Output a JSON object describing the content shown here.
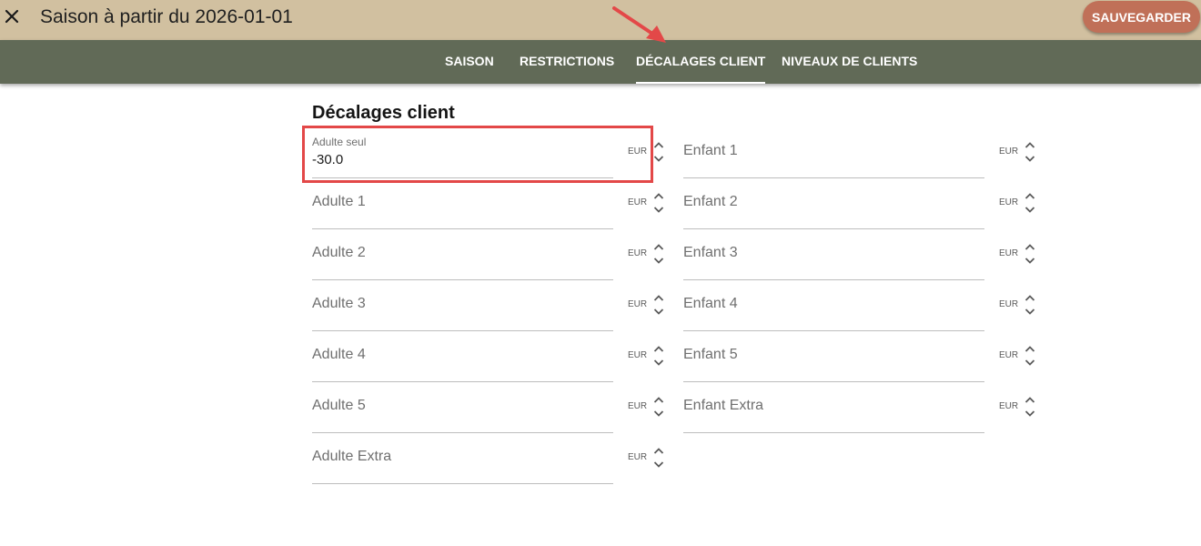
{
  "header": {
    "title": "Saison à partir du 2026-01-01",
    "save_label": "SAUVEGARDER",
    "close_icon": "close-icon"
  },
  "tabs": [
    {
      "label": "SAISON",
      "active": false
    },
    {
      "label": "RESTRICTIONS",
      "active": false
    },
    {
      "label": "DÉCALAGES CLIENT",
      "active": true
    },
    {
      "label": "NIVEAUX DE CLIENTS",
      "active": false
    }
  ],
  "section": {
    "title": "Décalages client"
  },
  "adult_fields": [
    {
      "label": "Adulte seul",
      "value": "-30.0",
      "unit": "EUR"
    },
    {
      "label": "Adulte 1",
      "value": "",
      "unit": "EUR"
    },
    {
      "label": "Adulte 2",
      "value": "",
      "unit": "EUR"
    },
    {
      "label": "Adulte 3",
      "value": "",
      "unit": "EUR"
    },
    {
      "label": "Adulte 4",
      "value": "",
      "unit": "EUR"
    },
    {
      "label": "Adulte 5",
      "value": "",
      "unit": "EUR"
    },
    {
      "label": "Adulte Extra",
      "value": "",
      "unit": "EUR"
    }
  ],
  "child_fields": [
    {
      "label": "Enfant 1",
      "value": "",
      "unit": "EUR"
    },
    {
      "label": "Enfant 2",
      "value": "",
      "unit": "EUR"
    },
    {
      "label": "Enfant 3",
      "value": "",
      "unit": "EUR"
    },
    {
      "label": "Enfant 4",
      "value": "",
      "unit": "EUR"
    },
    {
      "label": "Enfant 5",
      "value": "",
      "unit": "EUR"
    },
    {
      "label": "Enfant Extra",
      "value": "",
      "unit": "EUR"
    }
  ],
  "colors": {
    "header_bg": "#d1c0a0",
    "tabbar_bg": "#616a57",
    "save_button": "#c07058",
    "annotation_red": "#e34848"
  }
}
